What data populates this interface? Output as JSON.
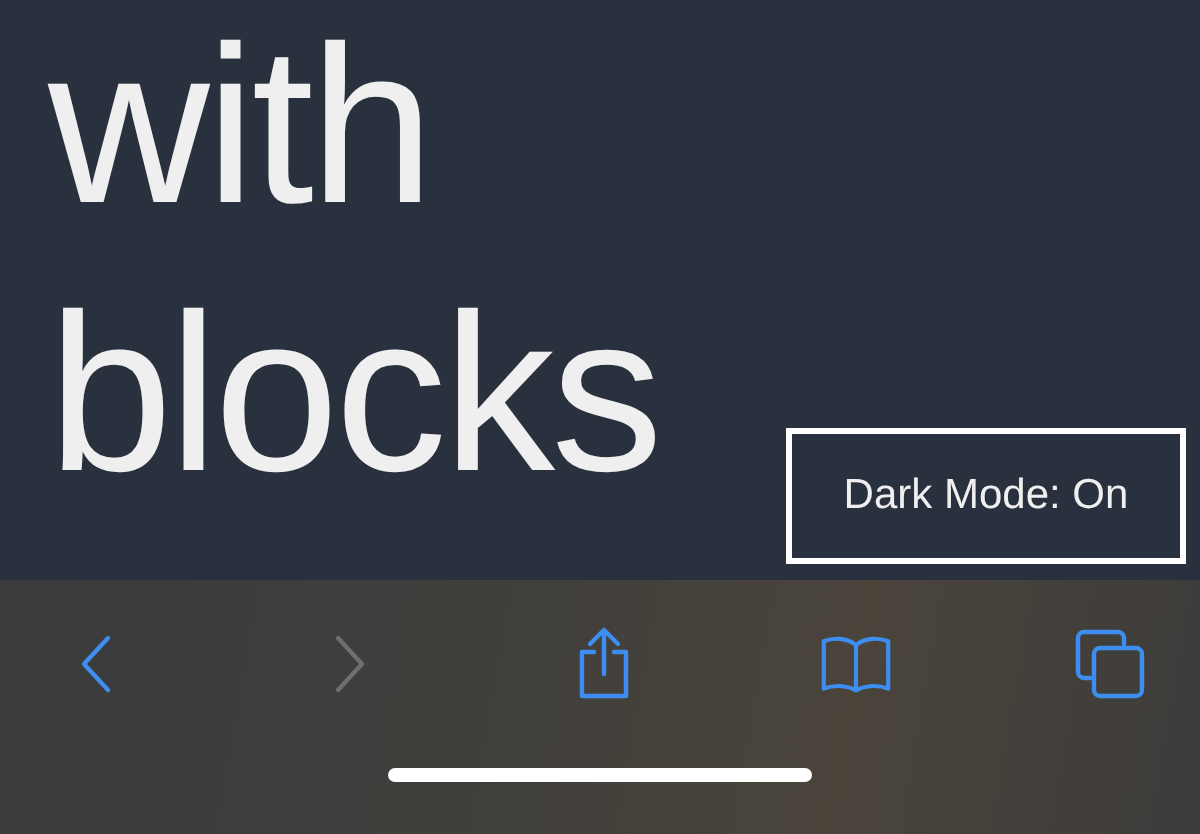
{
  "content": {
    "lines": [
      "with",
      "blocks"
    ]
  },
  "badge": {
    "text": "Dark Mode: On"
  },
  "toolbar": {
    "buttons": [
      {
        "kind": "back",
        "disabled": false
      },
      {
        "kind": "forward",
        "disabled": true
      },
      {
        "kind": "share",
        "disabled": false
      },
      {
        "kind": "bookmarks",
        "disabled": false
      },
      {
        "kind": "tabs",
        "disabled": false
      }
    ]
  }
}
